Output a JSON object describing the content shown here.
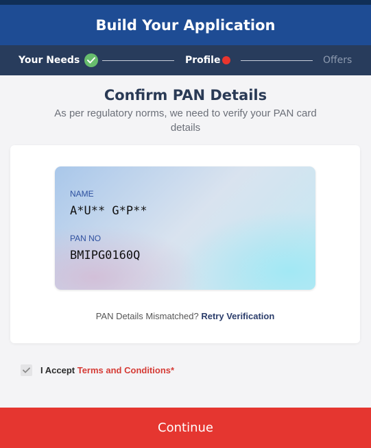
{
  "header": {
    "title": "Build Your Application"
  },
  "stepper": {
    "steps": [
      {
        "label": "Your Needs",
        "state": "done"
      },
      {
        "label": "Profile",
        "state": "current"
      },
      {
        "label": "Offers",
        "state": "upcoming"
      }
    ]
  },
  "main": {
    "title": "Confirm PAN Details",
    "subtitle": "As per regulatory norms, we need to verify your PAN card details"
  },
  "pan_card": {
    "name_label": "NAME",
    "name_value": "A*U** G*P**",
    "pan_label": "PAN NO",
    "pan_value": "BMIPG0160Q"
  },
  "verification": {
    "mismatch_text": "PAN Details Mismatched?",
    "retry_label": "Retry Verification"
  },
  "consent": {
    "checked": true,
    "prefix": "I Accept",
    "terms_label": "Terms and Conditions*"
  },
  "footer": {
    "continue_label": "Continue"
  },
  "colors": {
    "header_bg": "#1e4c94",
    "stepper_bg": "#283c5c",
    "step_done": "#67bd6d",
    "step_current": "#e8352e",
    "primary_button": "#e53630",
    "link": "#2b3d6b",
    "terms_link": "#d53b35"
  },
  "icons": {
    "step_done": "check-icon",
    "step_current": "status-dot-icon",
    "consent": "checkbox-check-icon"
  }
}
